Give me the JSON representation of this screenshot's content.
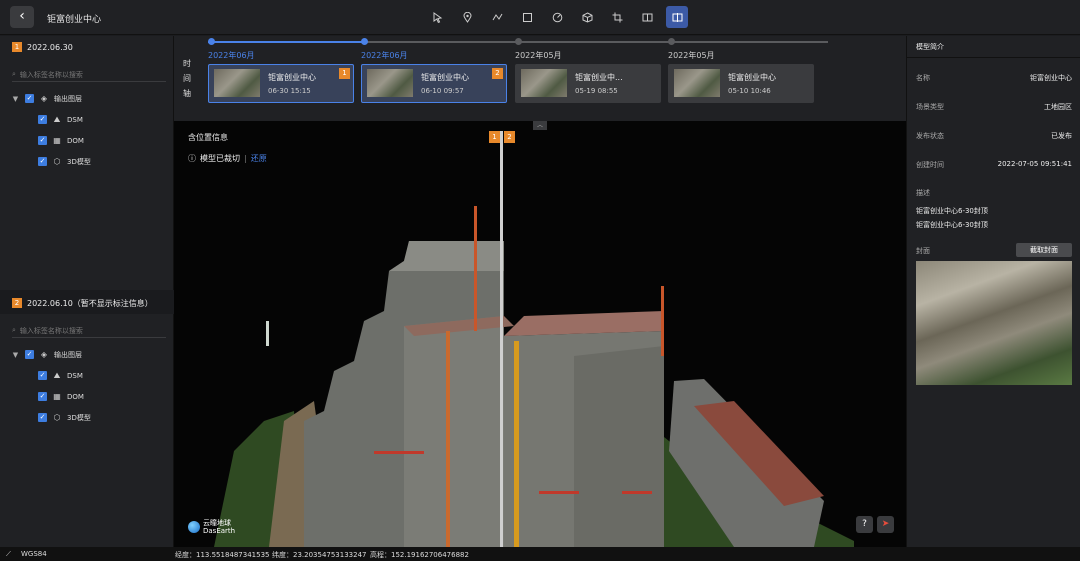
{
  "header": {
    "back_icon": "chevron-left-icon",
    "title": "钜富创业中心",
    "tools": [
      "cursor-icon",
      "location-pin-icon",
      "polyline-icon",
      "rectangle-select-icon",
      "compass-icon",
      "cube-icon",
      "crop-icon",
      "split-icon",
      "split-compare-icon"
    ]
  },
  "left": {
    "sections": [
      {
        "num": "1",
        "title": "2022.06.30",
        "search_placeholder": "输入标签名称以搜索",
        "root": "输出图层",
        "items": [
          "DSM",
          "DOM",
          "3D模型"
        ]
      },
      {
        "num": "2",
        "title": "2022.06.10（暂不显示标注信息）",
        "search_placeholder": "输入标签名称以搜索",
        "root": "输出图层",
        "items": [
          "DSM",
          "DOM",
          "3D模型"
        ]
      }
    ]
  },
  "timeline": {
    "label": "时间轴",
    "items": [
      {
        "date": "2022年06月",
        "title": "钜富创业中心",
        "time": "06-30 15:15",
        "badge": "1",
        "active": true
      },
      {
        "date": "2022年06月",
        "title": "钜富创业中心",
        "time": "06-10 09:57",
        "badge": "2",
        "active": true
      },
      {
        "date": "2022年05月",
        "title": "钜富创业中...",
        "time": "05-19 08:55",
        "badge": "",
        "active": false
      },
      {
        "date": "2022年05月",
        "title": "钜富创业中心",
        "time": "05-10 10:46",
        "badge": "",
        "active": false
      }
    ]
  },
  "viewport": {
    "label": "含位置信息",
    "clip_text": "模型已裁切",
    "restore": "还原",
    "split_badges": [
      "1",
      "2"
    ],
    "logo_cn": "云瞳地球",
    "logo_en": "DasEarth"
  },
  "right": {
    "title": "模型简介",
    "props": [
      {
        "k": "名称",
        "v": "钜富创业中心"
      },
      {
        "k": "场景类型",
        "v": "工地园区"
      },
      {
        "k": "发布状态",
        "v": "已发布"
      },
      {
        "k": "创建时间",
        "v": "2022-07-05 09:51:41"
      }
    ],
    "desc_label": "描述",
    "desc_lines": [
      "钜富创业中心6-30封顶",
      "钜富创业中心6-30封顶"
    ],
    "cover_label": "封面",
    "cover_button": "截取封面"
  },
  "status": {
    "crs": "WGS84",
    "lng": "经度：113.5518487341535",
    "lat": "纬度：23.20354753133247",
    "alt": "高程：152.19162706476882"
  }
}
